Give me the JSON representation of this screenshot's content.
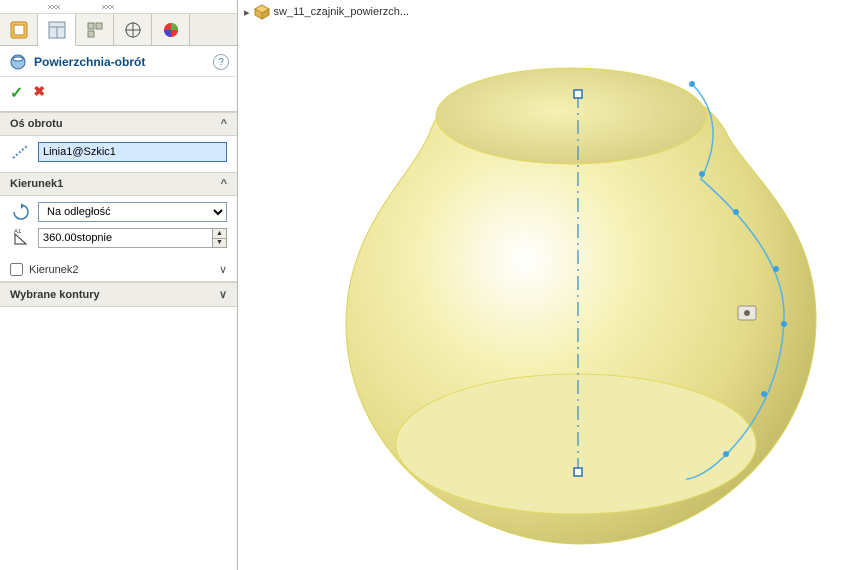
{
  "feature": {
    "title": "Powierzchnia-obrót",
    "help_tooltip": "?"
  },
  "sections": {
    "axis": {
      "label": "Oś obrotu",
      "axis_value": "Linia1@Szkic1"
    },
    "direction1": {
      "label": "Kierunek1",
      "type_options": [
        "Na odległość"
      ],
      "type_selected": "Na odległość",
      "angle_value": "360.00stopnie"
    },
    "direction2": {
      "label": "Kierunek2",
      "checked": false
    },
    "contours": {
      "label": "Wybrane kontury"
    }
  },
  "breadcrumb": {
    "part_name": "sw_11_czajnik_powierzch..."
  },
  "colors": {
    "cmdTitle": "#0b4a82",
    "highlightBg": "#d6eaff"
  }
}
